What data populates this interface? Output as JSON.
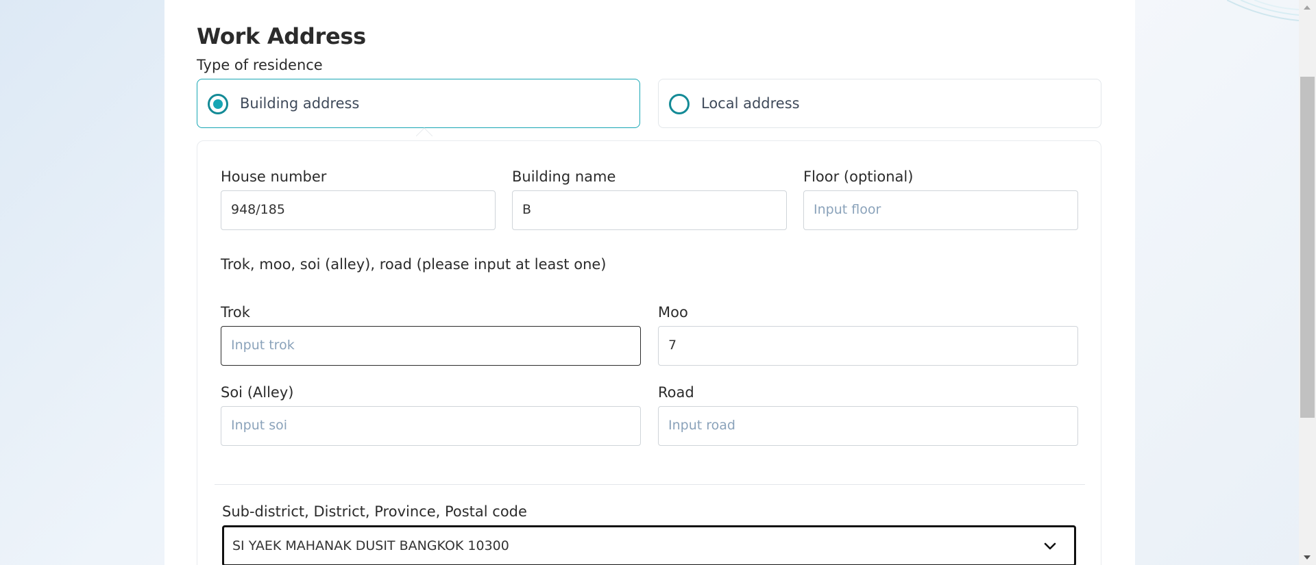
{
  "work_address": {
    "title": "Work Address",
    "residence_type_label": "Type of residence",
    "options": [
      {
        "label": "Building address",
        "selected": true
      },
      {
        "label": "Local address",
        "selected": false
      }
    ]
  },
  "building_fields": {
    "house_number": {
      "label": "House number",
      "value": "948/185"
    },
    "building_name": {
      "label": "Building name",
      "value": "B"
    },
    "floor": {
      "label": "Floor (optional)",
      "value": "",
      "placeholder": "Input floor"
    }
  },
  "road_section": {
    "note": "Trok, moo, soi (alley), road (please input at least one)",
    "trok": {
      "label": "Trok",
      "value": "",
      "placeholder": "Input trok"
    },
    "moo": {
      "label": "Moo",
      "value": "7"
    },
    "soi": {
      "label": "Soi (Alley)",
      "value": "",
      "placeholder": "Input soi"
    },
    "road": {
      "label": "Road",
      "value": "",
      "placeholder": "Input road"
    }
  },
  "location": {
    "label": "Sub-district, District, Province, Postal code",
    "selected_value": "SI YAEK MAHANAK DUSIT BANGKOK 10300"
  },
  "theme": {
    "accent": "#17a6b4",
    "placeholder_color": "#8aa2ba"
  },
  "icons": {
    "radio_selected": "radio-checked-icon",
    "radio_unselected": "radio-unchecked-icon",
    "dropdown": "chevron-down-icon"
  }
}
